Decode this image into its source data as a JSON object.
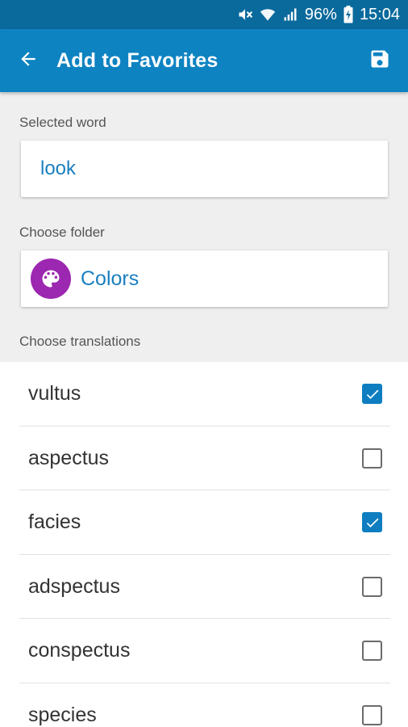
{
  "status_bar": {
    "icons": [
      "mute-icon",
      "wifi-icon",
      "signal-icon",
      "battery-charging-icon"
    ],
    "battery": "96%",
    "time": "15:04"
  },
  "app_bar": {
    "title": "Add to Favorites",
    "back_icon": "arrow-back-icon",
    "save_icon": "save-icon",
    "color": "#0e83c2"
  },
  "selected_word": {
    "label": "Selected word",
    "value": "look"
  },
  "folder": {
    "label": "Choose folder",
    "name": "Colors",
    "icon": "palette-icon",
    "icon_color": "#9c27b0"
  },
  "translations": {
    "label": "Choose translations",
    "items": [
      {
        "text": "vultus",
        "checked": true
      },
      {
        "text": "aspectus",
        "checked": false
      },
      {
        "text": "facies",
        "checked": true
      },
      {
        "text": "adspectus",
        "checked": false
      },
      {
        "text": "conspectus",
        "checked": false
      },
      {
        "text": "species",
        "checked": false
      }
    ]
  }
}
